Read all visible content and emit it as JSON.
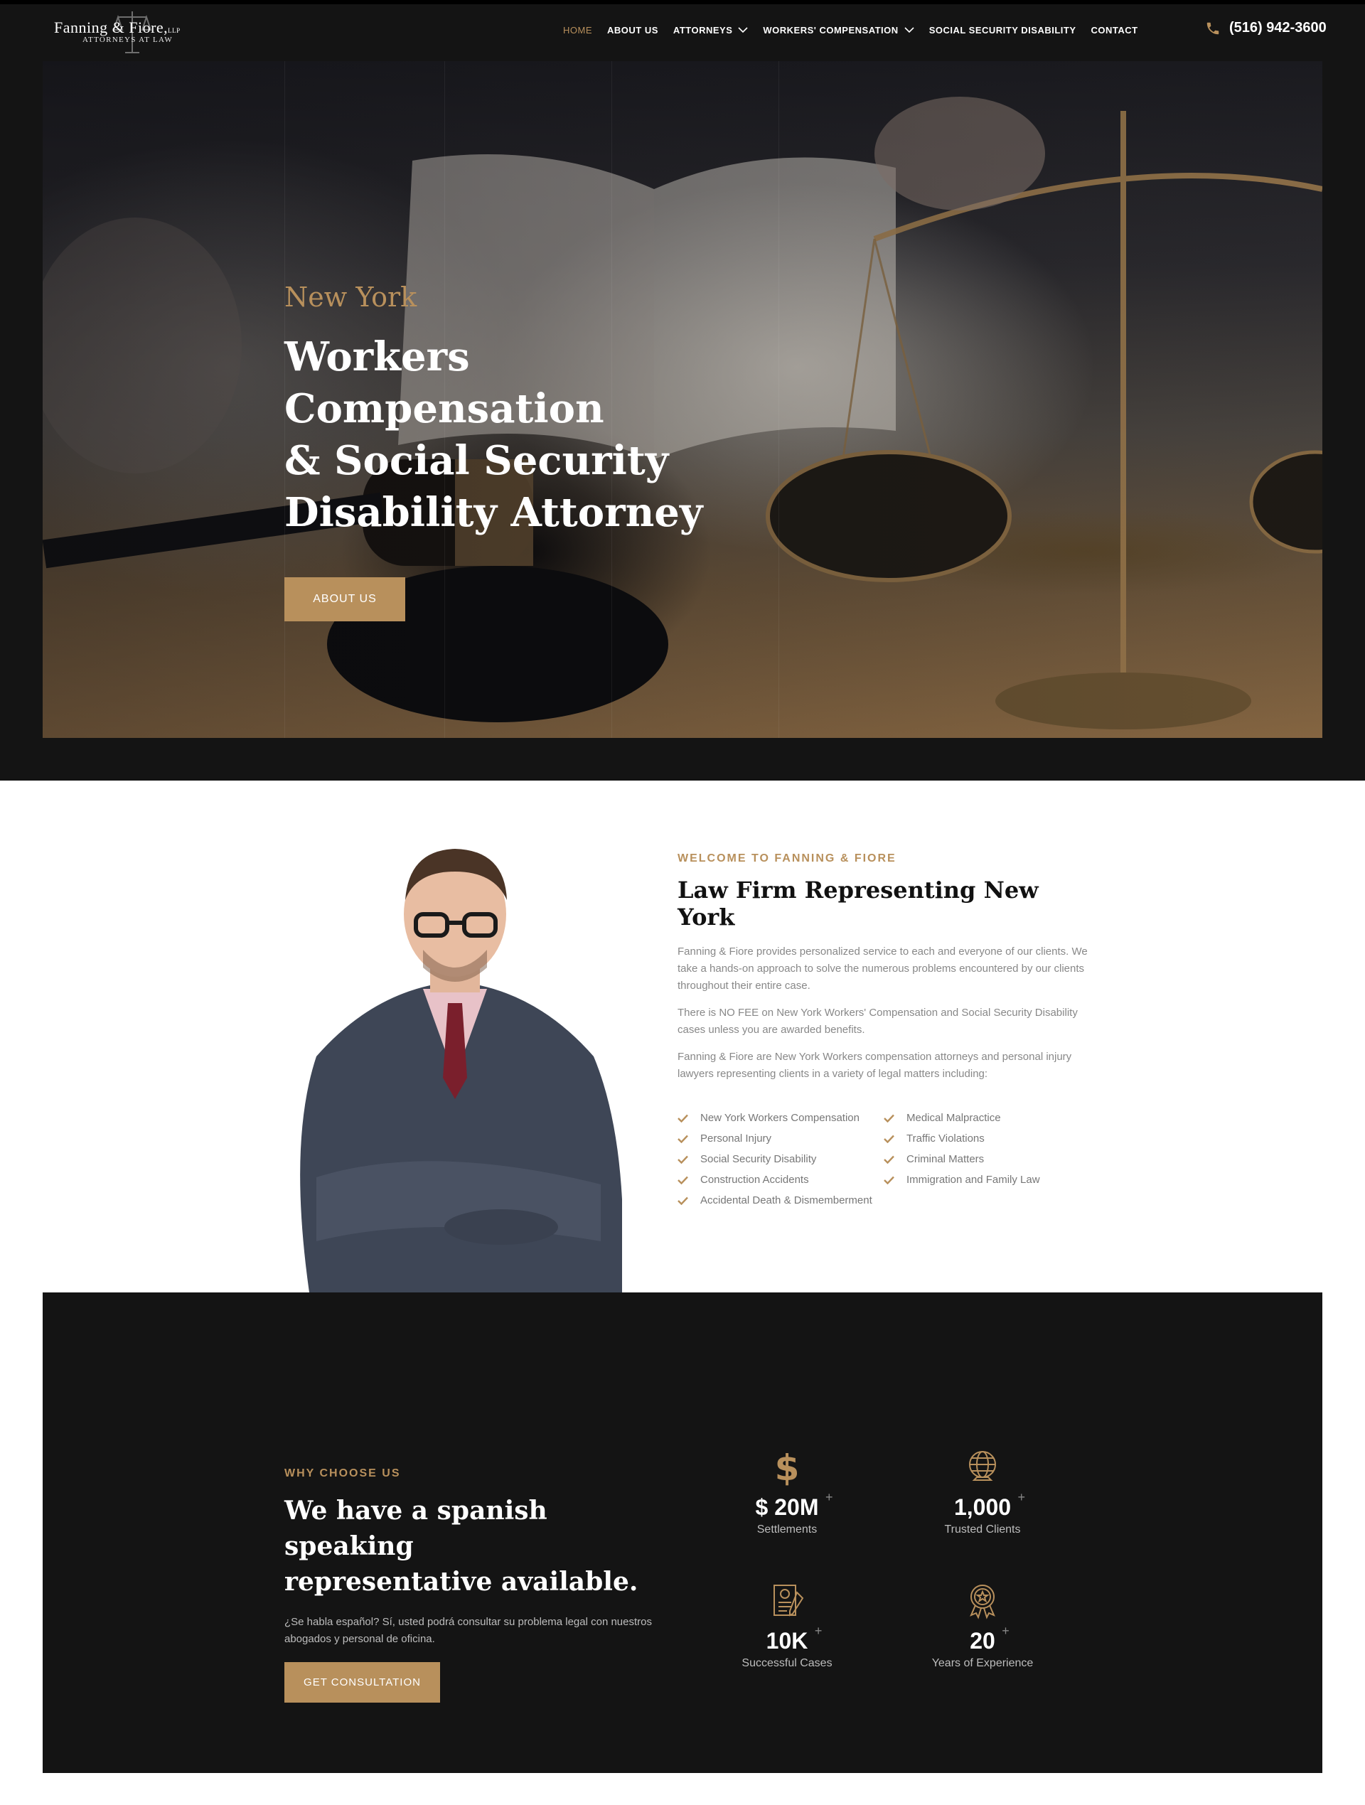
{
  "header": {
    "logo_name": "Fanning & Fiore,",
    "logo_suffix": "LLP",
    "logo_sub": "ATTORNEYS AT LAW",
    "nav": [
      {
        "label": "HOME"
      },
      {
        "label": "ABOUT US"
      },
      {
        "label": "ATTORNEYS"
      },
      {
        "label": "WORKERS' COMPENSATION"
      },
      {
        "label": "SOCIAL SECURITY DISABILITY"
      },
      {
        "label": "CONTACT"
      }
    ],
    "phone": "(516) 942-3600"
  },
  "hero": {
    "eyebrow": "New York",
    "title_line1": "Workers Compensation",
    "title_line2": "& Social Security",
    "title_line3": "Disability Attorney",
    "button": "ABOUT US"
  },
  "welcome": {
    "eyebrow": "WELCOME TO FANNING & FIORE",
    "title": "Law Firm Representing New York",
    "paragraphs": [
      "Fanning & Fiore provides personalized service to each and everyone of our clients. We take a hands-on approach to solve the numerous problems encountered by our clients throughout their entire case.",
      "There is NO FEE on New York Workers' Compensation and Social Security Disability cases unless you are awarded benefits.",
      "Fanning & Fiore are New York Workers compensation attorneys and personal injury lawyers representing clients in a variety of legal matters including:"
    ],
    "services_left": [
      "New York Workers Compensation",
      "Personal Injury",
      "Social Security Disability",
      "Construction Accidents",
      "Accidental Death & Dismemberment"
    ],
    "services_right": [
      "Medical Malpractice",
      "Traffic Violations",
      "Criminal Matters",
      "Immigration and Family Law"
    ]
  },
  "why": {
    "eyebrow": "WHY CHOOSE US",
    "title_line1": "We have a spanish speaking",
    "title_line2": "representative available.",
    "paragraph": "¿Se habla español? Sí, usted podrá consultar su problema legal con nuestros abogados y personal de oficina.",
    "button": "GET CONSULTATION",
    "stats": [
      {
        "icon": "dollar-icon",
        "value": "$ 20M",
        "plus": "+",
        "label": "Settlements"
      },
      {
        "icon": "globe-icon",
        "value": "1,000",
        "plus": "+",
        "label": "Trusted Clients"
      },
      {
        "icon": "certificate-icon",
        "value": "10K",
        "plus": "+",
        "label": "Successful Cases"
      },
      {
        "icon": "award-icon",
        "value": "20",
        "plus": "+",
        "label": "Years of Experience"
      }
    ]
  },
  "colors": {
    "accent": "#b8905c",
    "dark": "#141414",
    "white": "#ffffff",
    "muted_text": "#888888"
  }
}
